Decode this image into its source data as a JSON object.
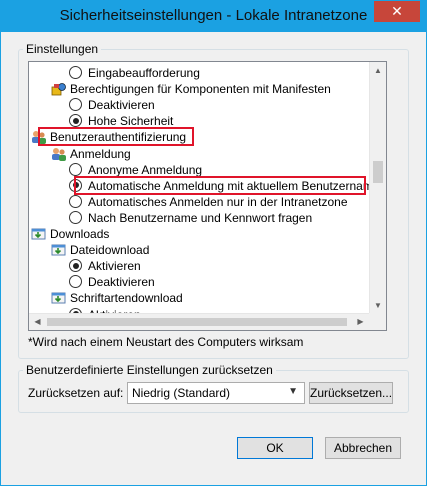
{
  "window": {
    "title": "Sicherheitseinstellungen - Lokale Intranetzone",
    "close_label": "✕"
  },
  "settings_group": {
    "title": "Einstellungen"
  },
  "tree": {
    "rows": [
      {
        "kind": "radio",
        "checked": false,
        "label": "Eingabeaufforderung"
      },
      {
        "kind": "category",
        "icon": "gear-icon",
        "label": "Berechtigungen für Komponenten mit Manifesten"
      },
      {
        "kind": "radio",
        "checked": false,
        "label": "Deaktivieren"
      },
      {
        "kind": "radio",
        "checked": true,
        "label": "Hohe Sicherheit"
      },
      {
        "kind": "category",
        "icon": "users-icon",
        "label": "Benutzerauthentifizierung"
      },
      {
        "kind": "category",
        "icon": "users-icon",
        "label": "Anmeldung"
      },
      {
        "kind": "radio",
        "checked": false,
        "label": "Anonyme Anmeldung"
      },
      {
        "kind": "radio",
        "checked": true,
        "label": "Automatische Anmeldung mit aktuellem Benutzernamen u"
      },
      {
        "kind": "radio",
        "checked": false,
        "label": "Automatisches Anmelden nur in der Intranetzone"
      },
      {
        "kind": "radio",
        "checked": false,
        "label": "Nach Benutzername und Kennwort fragen"
      },
      {
        "kind": "category",
        "icon": "download-icon",
        "label": "Downloads"
      },
      {
        "kind": "category",
        "icon": "download-icon",
        "label": "Dateidownload"
      },
      {
        "kind": "radio",
        "checked": true,
        "label": "Aktivieren"
      },
      {
        "kind": "radio",
        "checked": false,
        "label": "Deaktivieren"
      },
      {
        "kind": "category",
        "icon": "download-icon",
        "label": "Schriftartendownload"
      },
      {
        "kind": "radio",
        "checked": true,
        "label": "Aktivieren"
      }
    ]
  },
  "note": "*Wird nach einem Neustart des Computers wirksam",
  "reset_group": {
    "title": "Benutzerdefinierte Einstellungen zurücksetzen",
    "label": "Zurücksetzen auf:",
    "combo_value": "Niedrig (Standard)",
    "reset_button": "Zurücksetzen..."
  },
  "footer": {
    "ok": "OK",
    "cancel": "Abbrechen"
  },
  "colors": {
    "titlebar": "#1ba1e2",
    "highlight_border": "#e0142a"
  }
}
